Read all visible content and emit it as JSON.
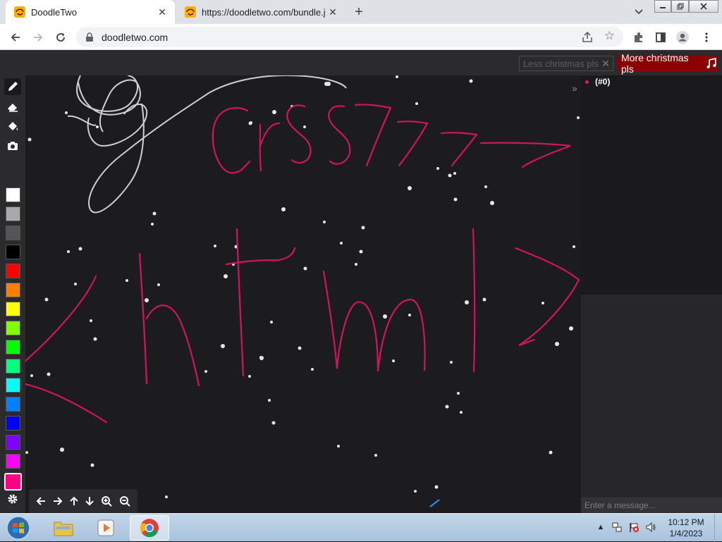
{
  "browser": {
    "tabs": [
      {
        "title": "DoodleTwo",
        "active": true
      },
      {
        "title": "https://doodletwo.com/bundle.js",
        "active": false
      }
    ],
    "url": "doodletwo.com",
    "new_tab_label": "+",
    "close_label": "✕"
  },
  "app": {
    "less_button_label": "Less christmas pls",
    "less_button_x": "✕",
    "more_button_label": "More christmas pls",
    "users": [
      {
        "name": "(#0)",
        "color": "#e0195f"
      }
    ],
    "collapse_label": "»",
    "chat_placeholder": "Enter a message...",
    "palette": [
      "#ffffff",
      "#a9a9a9",
      "#555555",
      "#000000",
      "#ff0000",
      "#ff8000",
      "#ffff00",
      "#80ff00",
      "#00ff00",
      "#00ff80",
      "#00ffff",
      "#0080ff",
      "#0000ff",
      "#8000ff",
      "#ff00ff",
      "#ff0080"
    ],
    "selected_color": "#ff0080",
    "tools": [
      "pencil-icon",
      "eraser-icon",
      "fill-bucket-icon",
      "camera-icon"
    ],
    "nav_controls": [
      "arrow-left-icon",
      "arrow-right-icon",
      "arrow-up-icon",
      "arrow-down-icon",
      "zoom-in-icon",
      "zoom-out-icon"
    ]
  },
  "drawing": {
    "stroke_color": "#d0145e",
    "scribble_color": "#cfcfcf"
  },
  "taskbar": {
    "time": "10:12 PM",
    "date": "1/4/2023"
  }
}
